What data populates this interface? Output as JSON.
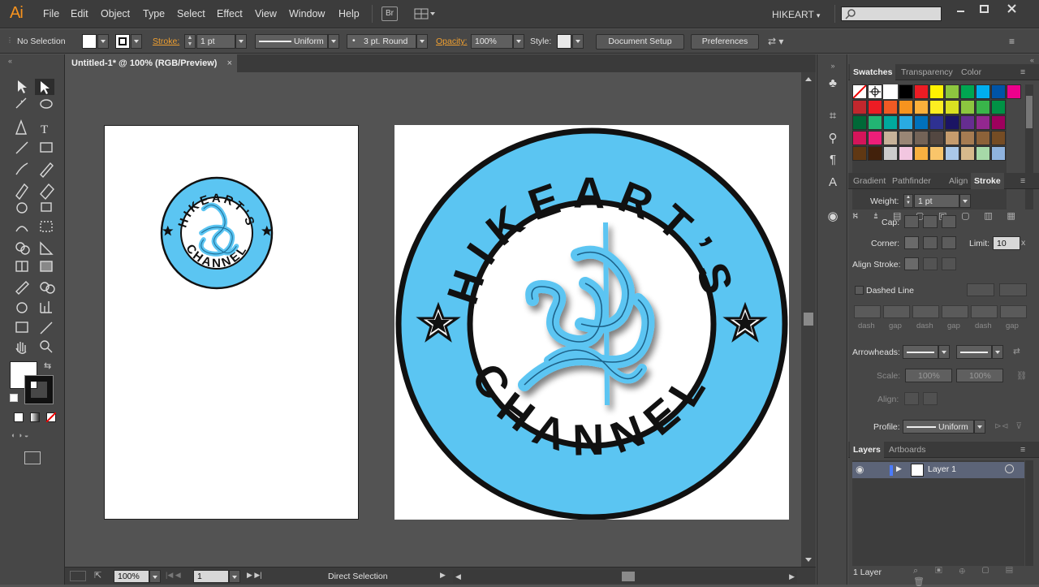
{
  "app": {
    "logo": "Ai",
    "workspace": "HIKEART",
    "bridge": "Br",
    "accent_color": "#f7931e"
  },
  "menu": [
    "File",
    "Edit",
    "Object",
    "Type",
    "Select",
    "Effect",
    "View",
    "Window",
    "Help"
  ],
  "control_bar": {
    "selection": "No Selection",
    "stroke_label": "Stroke:",
    "stroke_weight": "1 pt",
    "profile": "Uniform",
    "brush": "3 pt. Round",
    "opacity_label": "Opacity:",
    "opacity_value": "100%",
    "style_label": "Style:",
    "document_setup": "Document Setup",
    "preferences": "Preferences"
  },
  "document": {
    "tab_title": "Untitled-1* @ 100% (RGB/Preview)",
    "close_glyph": "×"
  },
  "logo_art": {
    "top_text": "HIKEART’S",
    "bottom_text": "CHANNEL",
    "ring_color": "#5bc5f2",
    "outline_color": "#111111"
  },
  "status_bar": {
    "zoom": "100%",
    "artboard": "1",
    "tool": "Direct Selection"
  },
  "panels": {
    "swatch_tabs": [
      "Swatches",
      "Transparency",
      "Color"
    ],
    "stroke_tabs": [
      "Gradient",
      "Pathfinder",
      "Align",
      "Stroke"
    ],
    "stroke": {
      "weight_label": "Weight:",
      "weight_value": "1 pt",
      "cap_label": "Cap:",
      "corner_label": "Corner:",
      "limit_label": "Limit:",
      "limit_value": "10",
      "align_label": "Align Stroke:",
      "dashed_label": "Dashed Line",
      "dash_labels": [
        "dash",
        "gap",
        "dash",
        "gap",
        "dash",
        "gap"
      ],
      "arrowheads_label": "Arrowheads:",
      "scale_label": "Scale:",
      "scale_start": "100%",
      "scale_end": "100%",
      "align_arrow_label": "Align:",
      "profile_label": "Profile:",
      "profile_value": "Uniform"
    },
    "layers_tabs": [
      "Layers",
      "Artboards"
    ],
    "layer_name": "Layer 1",
    "layers_count": "1 Layer"
  },
  "swatch_colors": [
    [
      "#ffffff",
      "#ffffff",
      "#ffffff",
      "#000000",
      "#ed1c24",
      "#fff200",
      "#8dc63f",
      "#00a651",
      "#00aeef",
      "#0054a6",
      "#ec008c"
    ],
    [
      "#c1272d",
      "#ed1c24",
      "#f15a24",
      "#f7931e",
      "#fbb03b",
      "#fcee21",
      "#d9e021",
      "#8cc63f",
      "#39b54a",
      "#009245"
    ],
    [
      "#006837",
      "#22b573",
      "#00a99d",
      "#29abe2",
      "#0071bc",
      "#2e3192",
      "#1b1464",
      "#662d91",
      "#93278f",
      "#9e005d"
    ],
    [
      "#d4145a",
      "#ed1e79",
      "#c7b299",
      "#998675",
      "#736357",
      "#534741",
      "#c69c6d",
      "#a67c52",
      "#8c6239",
      "#754c24"
    ],
    [
      "#603813",
      "#42210b",
      "#cccccc",
      "#f2c6e0",
      "#f7b040",
      "#f9c56a",
      "#aac8e8",
      "#d6b98c",
      "#a6d9a8",
      "#8fb3de"
    ]
  ]
}
